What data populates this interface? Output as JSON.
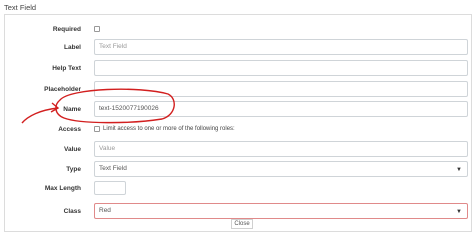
{
  "section": {
    "title": "Text Field"
  },
  "form": {
    "required_label": "Required",
    "label_label": "Label",
    "label_placeholder": "Text Field",
    "help_text_label": "Help Text",
    "placeholder_label": "Placeholder",
    "name_label": "Name",
    "name_value": "text-1520077190026",
    "access_label": "Access",
    "access_text": "Limit access to one or more of the following roles:",
    "value_label": "Value",
    "value_placeholder": "Value",
    "type_label": "Type",
    "type_selected": "Text Field",
    "max_length_label": "Max Length",
    "class_label": "Class",
    "class_value": "Red"
  },
  "footer": {
    "close_label": "Close"
  },
  "colors": {
    "annotation": "#d21f1f",
    "class_border": "#e08a8a"
  }
}
